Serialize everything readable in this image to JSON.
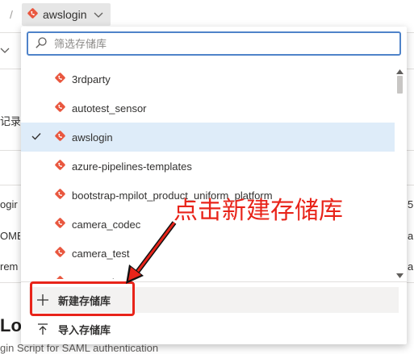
{
  "breadcrumb": {
    "separator": "/"
  },
  "repo_picker": {
    "label": "awslogin",
    "icon": "git-repo-icon"
  },
  "background": {
    "frag_history": "记录",
    "frag_rows": [
      "ogir",
      "OME.",
      "rem"
    ],
    "frag_right": [
      "5",
      "a",
      "a"
    ],
    "title": "Logi",
    "subtitle": "gin Script for SAML authentication"
  },
  "dropdown": {
    "search_placeholder": "筛选存储库",
    "repos": [
      {
        "name": "3rdparty",
        "selected": false
      },
      {
        "name": "autotest_sensor",
        "selected": false
      },
      {
        "name": "awslogin",
        "selected": true
      },
      {
        "name": "azure-pipelines-templates",
        "selected": false
      },
      {
        "name": "bootstrap-mpilot_product_uniform_platform",
        "selected": false
      },
      {
        "name": "camera_codec",
        "selected": false
      },
      {
        "name": "camera_test",
        "selected": false
      },
      {
        "name": "conan_abseil",
        "selected": false
      }
    ],
    "new_repo_label": "新建存储库",
    "import_repo_label": "导入存储库"
  },
  "annotation": {
    "text": "点击新建存储库",
    "color": "#e8241a"
  },
  "colors": {
    "git_icon": "#e9573f",
    "accent": "#4f83c9",
    "selected_bg": "#deecf9"
  }
}
